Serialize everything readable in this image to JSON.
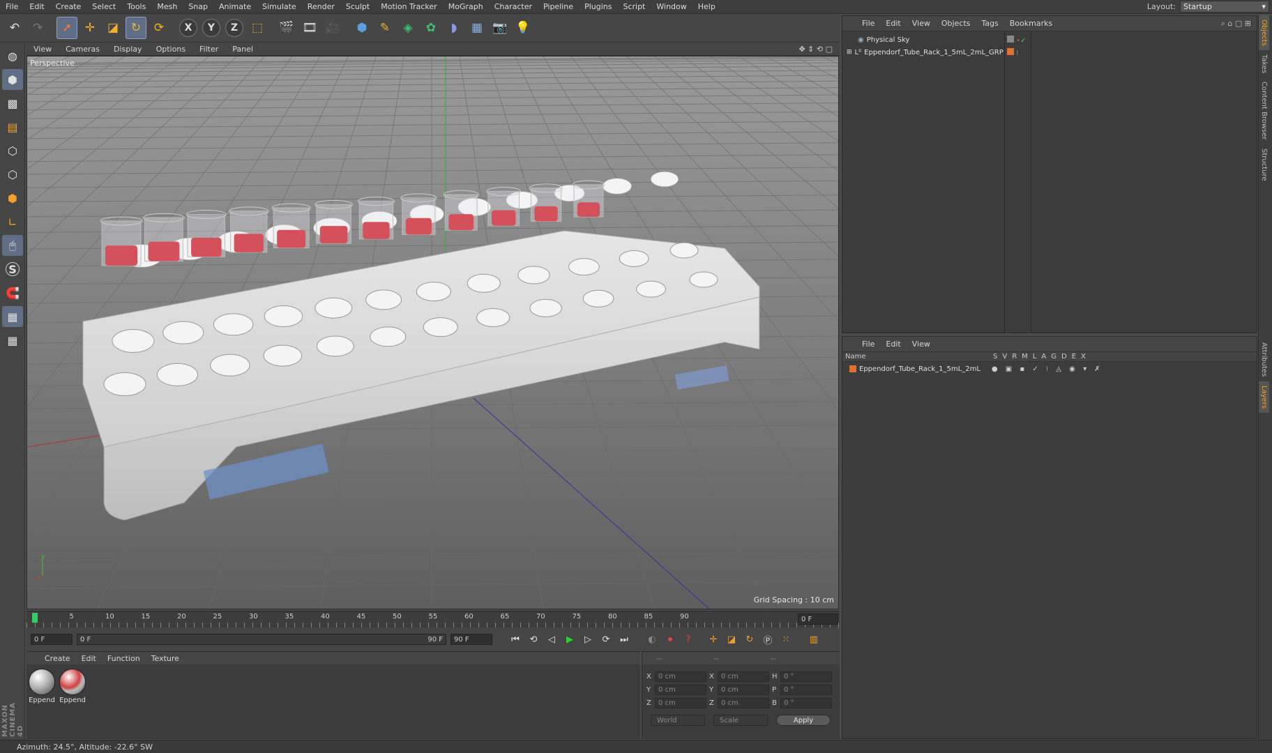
{
  "menubar": {
    "items": [
      "File",
      "Edit",
      "Create",
      "Select",
      "Tools",
      "Mesh",
      "Snap",
      "Animate",
      "Simulate",
      "Render",
      "Sculpt",
      "Motion Tracker",
      "MoGraph",
      "Character",
      "Pipeline",
      "Plugins",
      "Script",
      "Window",
      "Help"
    ],
    "layout_label": "Layout:",
    "layout_value": "Startup"
  },
  "toolbar": {
    "x_label": "X",
    "y_label": "Y",
    "z_label": "Z"
  },
  "viewport": {
    "menu": [
      "View",
      "Cameras",
      "Display",
      "Options",
      "Filter",
      "Panel"
    ],
    "camera_label": "Perspective",
    "grid_spacing": "Grid Spacing : 10 cm"
  },
  "timeline": {
    "ticks": [
      "0",
      "5",
      "10",
      "15",
      "20",
      "25",
      "30",
      "35",
      "40",
      "45",
      "50",
      "55",
      "60",
      "65",
      "70",
      "75",
      "80",
      "85",
      "90"
    ],
    "end_frame": "0 F"
  },
  "transport": {
    "current_frame": "0 F",
    "range_start": "0 F",
    "range_end": "90 F",
    "max_frame": "90 F"
  },
  "materials": {
    "menu": [
      "Create",
      "Edit",
      "Function",
      "Texture"
    ],
    "items": [
      {
        "label": "Eppend"
      },
      {
        "label": "Eppend"
      }
    ]
  },
  "coordinates": {
    "pos_labels": [
      "X",
      "Y",
      "Z"
    ],
    "size_labels": [
      "X",
      "Y",
      "Z"
    ],
    "rot_labels": [
      "H",
      "P",
      "B"
    ],
    "pos_values": [
      "0 cm",
      "0 cm",
      "0 cm"
    ],
    "size_values": [
      "0 cm",
      "0 cm",
      "0 cm"
    ],
    "rot_values": [
      "0 °",
      "0 °",
      "0 °"
    ],
    "header_dash1": "--",
    "header_dash2": "--",
    "header_dash3": "--",
    "world": "World",
    "scale": "Scale",
    "apply": "Apply"
  },
  "objects_panel": {
    "menu": [
      "File",
      "Edit",
      "View",
      "Objects",
      "Tags",
      "Bookmarks"
    ],
    "rows": [
      {
        "name": "Physical Sky"
      },
      {
        "name": "Eppendorf_Tube_Rack_1_5mL_2mL_GRP"
      }
    ]
  },
  "layers_panel": {
    "menu": [
      "File",
      "Edit",
      "View"
    ],
    "header_name": "Name",
    "columns": [
      "S",
      "V",
      "R",
      "M",
      "L",
      "A",
      "G",
      "D",
      "E",
      "X"
    ],
    "rows": [
      {
        "name": "Eppendorf_Tube_Rack_1_5mL_2mL"
      }
    ]
  },
  "right_tabs": [
    "Objects",
    "Takes",
    "Content Browser",
    "Structure",
    "Attributes",
    "Layers"
  ],
  "status": {
    "text": "Azimuth: 24.5°, Altitude: -22.6°  SW"
  },
  "branding": {
    "text": "MAXON CINEMA 4D"
  },
  "colors": {
    "accent": "#5f6d85",
    "orange": "#e07030",
    "tube_fill": "#d4505a",
    "play_green": "#33cc33"
  }
}
